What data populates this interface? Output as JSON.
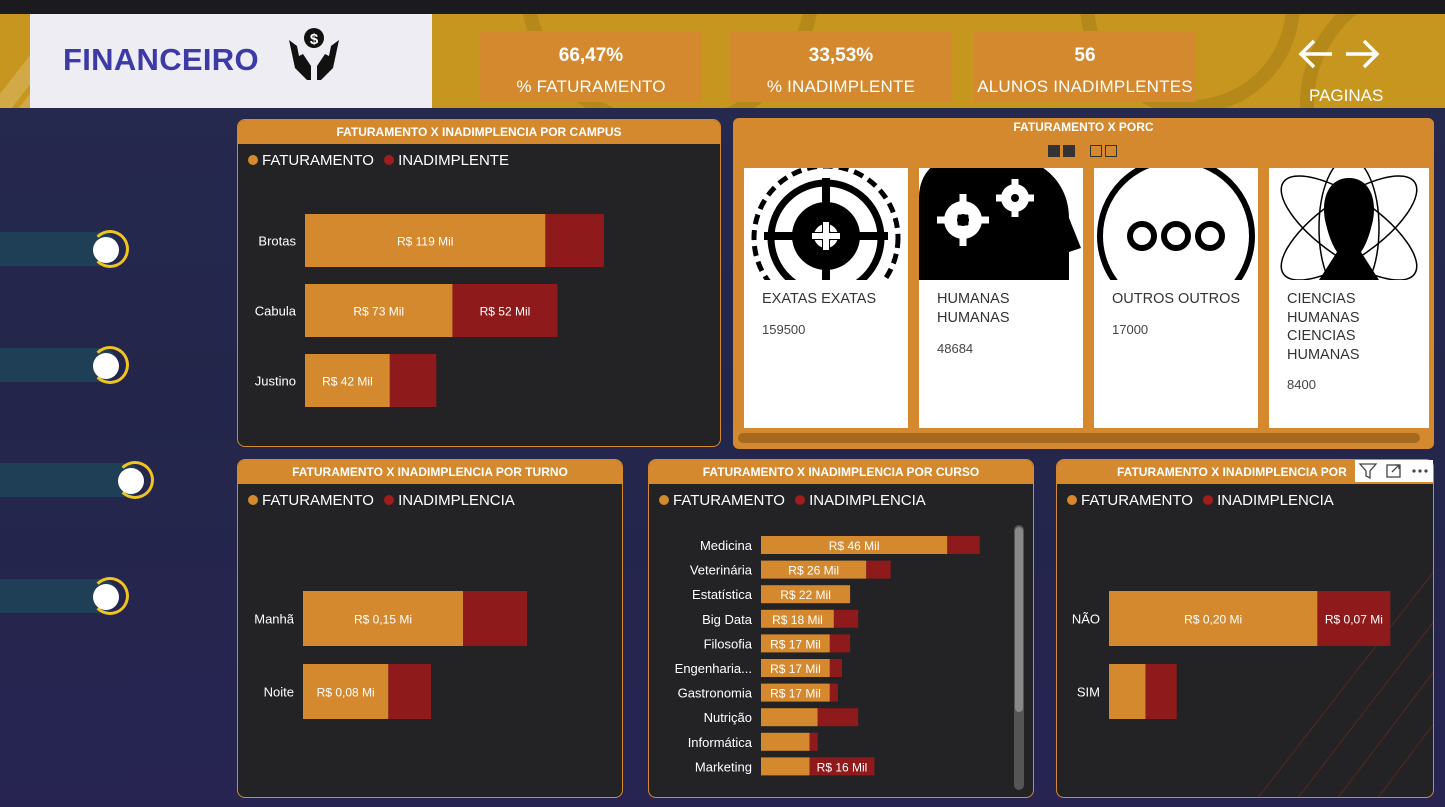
{
  "header": {
    "title": "FINANCEIRO",
    "kpis": [
      {
        "value": "66,47%",
        "label": "% FATURAMENTO"
      },
      {
        "value": "33,53%",
        "label": "% INADIMPLENTE"
      },
      {
        "value": "56",
        "label": "ALUNOS INADIMPLENTES"
      }
    ],
    "nav_label": "PAGINAS"
  },
  "colors": {
    "faturamento": "#d4892e",
    "inadimplente": "#8e1a1b",
    "header_bg": "#c7961e",
    "panel_bg": "#232325"
  },
  "porc": {
    "title": "FATURAMENTO X PORC",
    "cards": [
      {
        "title": "EXATAS EXATAS",
        "value": "159500",
        "icon": "target-icon"
      },
      {
        "title": "HUMANAS HUMANAS",
        "value": "48684",
        "icon": "head-gears-icon"
      },
      {
        "title": "OUTROS OUTROS",
        "value": "17000",
        "icon": "ellipsis-circle-icon"
      },
      {
        "title": "CIENCIAS HUMANAS CIENCIAS HUMANAS",
        "value": "8400",
        "icon": "atom-person-icon"
      }
    ]
  },
  "chart_data": [
    {
      "type": "bar",
      "title": "FATURAMENTO X INADIMPLENCIA POR CAMPUS",
      "legend": [
        "FATURAMENTO",
        "INADIMPLENTE"
      ],
      "categories": [
        "Brotas",
        "Cabula",
        "Justino"
      ],
      "series": [
        {
          "name": "FATURAMENTO",
          "values": [
            119,
            73,
            42
          ],
          "labels": [
            "R$ 119 Mil",
            "R$ 73 Mil",
            "R$ 42 Mil"
          ]
        },
        {
          "name": "INADIMPLENTE",
          "values": [
            29,
            52,
            23
          ],
          "labels": [
            "",
            "R$ 52 Mil",
            ""
          ]
        }
      ],
      "stacked": true,
      "orientation": "horizontal"
    },
    {
      "type": "bar",
      "title": "FATURAMENTO X INADIMPLENCIA POR TURNO",
      "legend": [
        "FATURAMENTO",
        "INADIMPLENCIA"
      ],
      "categories": [
        "Manhã",
        "Noite"
      ],
      "series": [
        {
          "name": "FATURAMENTO",
          "values": [
            0.15,
            0.08
          ],
          "labels": [
            "R$ 0,15 Mi",
            "R$ 0,08 Mi"
          ]
        },
        {
          "name": "INADIMPLENCIA",
          "values": [
            0.06,
            0.04
          ],
          "labels": [
            "",
            ""
          ]
        }
      ],
      "stacked": true,
      "orientation": "horizontal"
    },
    {
      "type": "bar",
      "title": "FATURAMENTO X INADIMPLENCIA POR CURSO",
      "legend": [
        "FATURAMENTO",
        "INADIMPLENCIA"
      ],
      "categories": [
        "Medicina",
        "Veterinária",
        "Estatística",
        "Big Data",
        "Filosofia",
        "Engenharia...",
        "Gastronomia",
        "Nutrição",
        "Informática",
        "Marketing"
      ],
      "series": [
        {
          "name": "FATURAMENTO",
          "values": [
            46,
            26,
            22,
            18,
            17,
            17,
            17,
            14,
            12,
            12
          ],
          "labels": [
            "R$ 46 Mil",
            "R$ 26 Mil",
            "R$ 22 Mil",
            "R$ 18 Mil",
            "R$ 17 Mil",
            "R$ 17 Mil",
            "R$ 17 Mil",
            "",
            "",
            ""
          ]
        },
        {
          "name": "INADIMPLENCIA",
          "values": [
            8,
            6,
            0,
            6,
            5,
            3,
            2,
            10,
            2,
            16
          ],
          "labels": [
            "",
            "",
            "",
            "",
            "",
            "",
            "",
            "",
            "",
            "R$ 16 Mil"
          ]
        }
      ],
      "stacked": true,
      "orientation": "horizontal"
    },
    {
      "type": "bar",
      "title": "FATURAMENTO X INADIMPLENCIA POR",
      "legend": [
        "FATURAMENTO",
        "INADIMPLENCIA"
      ],
      "categories": [
        "NÃO",
        "SIM"
      ],
      "series": [
        {
          "name": "FATURAMENTO",
          "values": [
            0.2,
            0.035
          ],
          "labels": [
            "R$ 0,20 Mi",
            ""
          ]
        },
        {
          "name": "INADIMPLENCIA",
          "values": [
            0.07,
            0.03
          ],
          "labels": [
            "R$ 0,07 Mi",
            ""
          ]
        }
      ],
      "stacked": true,
      "orientation": "horizontal"
    }
  ]
}
